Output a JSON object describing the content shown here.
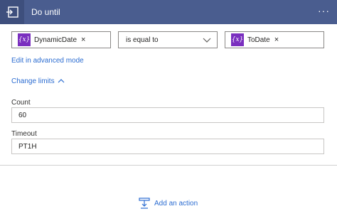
{
  "header": {
    "title": "Do until",
    "menu_glyph": "···",
    "icon": "loop-icon"
  },
  "condition": {
    "left_token": {
      "icon_text": "{x}",
      "label": "DynamicDate",
      "close": "×"
    },
    "operator": {
      "value": "is equal to",
      "icon": "chevron-down-icon"
    },
    "right_token": {
      "icon_text": "{x}",
      "label": "ToDate",
      "close": "×"
    }
  },
  "links": {
    "advanced_mode": "Edit in advanced mode",
    "change_limits": "Change limits"
  },
  "limits": {
    "count_label": "Count",
    "count_value": "60",
    "timeout_label": "Timeout",
    "timeout_value": "PT1H"
  },
  "footer": {
    "add_action_label": "Add an action",
    "icon": "add-step-icon"
  },
  "colors": {
    "header_bg": "#4a5d8f",
    "token_purple": "#7a2fbf",
    "link_blue": "#2b6cd1"
  }
}
